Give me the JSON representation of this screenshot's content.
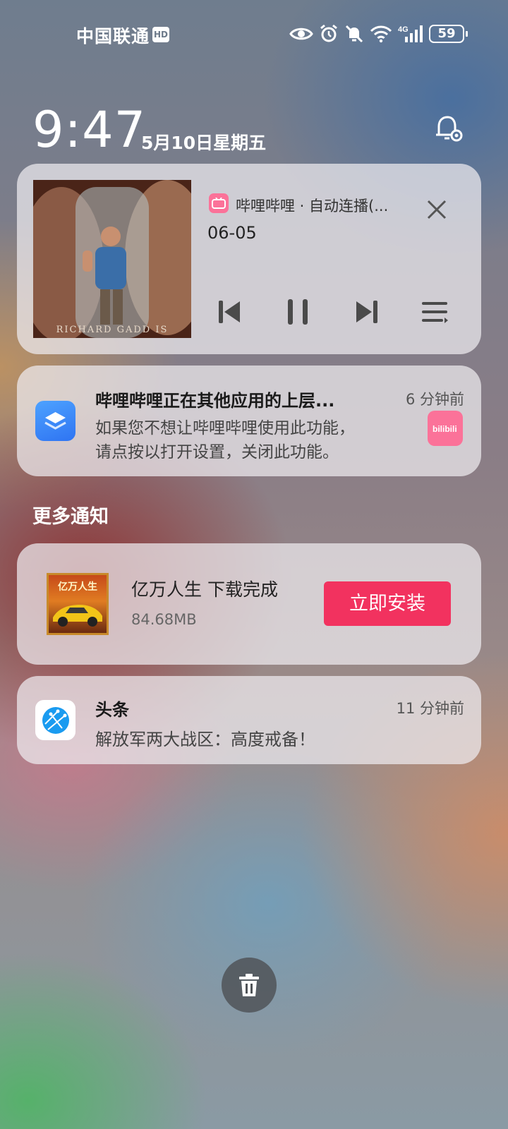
{
  "status_bar": {
    "carrier": "中国联通",
    "hd_badge": "HD",
    "network": "4G",
    "battery": "59",
    "icons": [
      "eye-icon",
      "alarm-icon",
      "bell-off-icon",
      "wifi-icon",
      "cellular-signal-icon",
      "battery-icon"
    ]
  },
  "lockscreen": {
    "time": "9:47",
    "date": "5月10日星期五"
  },
  "media_player": {
    "album_caption": "RICHARD GADD IS",
    "app_line": "哔哩哔哩 · 自动连播(...",
    "title": "06-05",
    "controls": [
      "previous-icon",
      "pause-icon",
      "next-icon",
      "playlist-icon"
    ]
  },
  "overlay_notification": {
    "title": "哔哩哔哩正在其他应用的上层...",
    "time": "6 分钟前",
    "body_line1": "如果您不想让哔哩哔哩使用此功能，",
    "body_line2": "请点按以打开设置，关闭此功能。",
    "badge_text": "bilibili"
  },
  "section": {
    "more_notifications": "更多通知"
  },
  "download_notification": {
    "icon_text": "亿万人生",
    "title": "亿万人生  下载完成",
    "size": "84.68MB",
    "install_label": "立即安装"
  },
  "news_notification": {
    "app": "头条",
    "time": "11 分钟前",
    "body": "解放军两大战区：高度戒备！"
  },
  "colors": {
    "accent_install": "#f2325f",
    "bilibili_pink": "#fb7299"
  }
}
